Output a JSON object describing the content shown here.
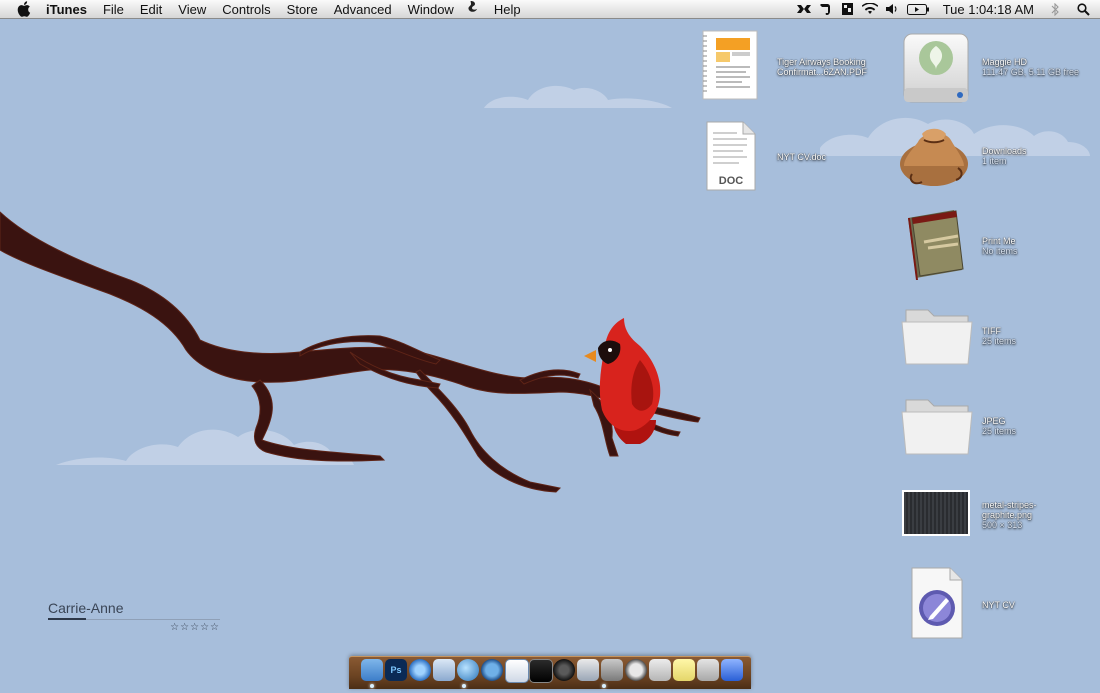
{
  "menubar": {
    "app_name": "iTunes",
    "items": [
      "File",
      "Edit",
      "View",
      "Controls",
      "Store",
      "Advanced",
      "Window",
      "Help"
    ],
    "clock": "Tue 1:04:18 AM"
  },
  "desktop": {
    "items": [
      {
        "name": "Tiger Airways Booking",
        "name2": "Confirmat...6ZAN.PDF",
        "sub": ""
      },
      {
        "name": "NYT CV.doc",
        "name2": "",
        "sub": "",
        "badge": "DOC"
      },
      {
        "name": "Maggie HD",
        "name2": "",
        "sub": "111.47 GB, 5.11 GB free"
      },
      {
        "name": "Downloads",
        "name2": "",
        "sub": "1 item"
      },
      {
        "name": "Print Me",
        "name2": "",
        "sub": "No items"
      },
      {
        "name": "TIFF",
        "name2": "",
        "sub": "25 items"
      },
      {
        "name": "JPEG",
        "name2": "",
        "sub": "25 items"
      },
      {
        "name": "metal-stripes-",
        "name2": "graphite.png",
        "sub": "500 × 313"
      },
      {
        "name": "NYT CV",
        "name2": "",
        "sub": ""
      }
    ]
  },
  "now_playing": {
    "track": "Carrie-Anne",
    "rating": "☆☆☆☆☆",
    "progress": 0.22
  },
  "dock": {
    "app_names": [
      "Finder",
      "Photoshop",
      "QuickTime",
      "Mail",
      "Network",
      "Time Machine",
      "Reminders",
      "Terminal",
      "Lens",
      "Preview",
      "Dashboard",
      "Speedometer",
      "Notes",
      "Stickies",
      "Applications",
      "Trash"
    ]
  },
  "colors": {
    "desktop": "#a7bedb",
    "cardinal": "#d8231d",
    "branch": "#3a1310",
    "dock_wood": "#6b4322"
  }
}
